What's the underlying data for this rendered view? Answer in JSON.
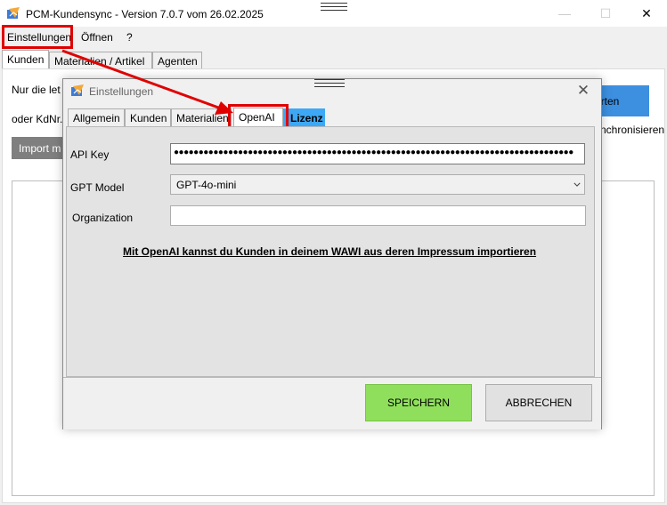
{
  "window": {
    "title": "PCM-Kundensync - Version 7.0.7 vom 26.02.2025",
    "minimize_glyph": "—",
    "maximize_glyph": "☐",
    "close_glyph": "✕"
  },
  "menu": {
    "items": [
      "Einstellungen",
      "Öffnen",
      "?"
    ]
  },
  "main_tabs": [
    "Kunden",
    "Materialien / Artikel",
    "Agenten"
  ],
  "main": {
    "line1_text": "Nur die let",
    "line2_text": "oder KdNr.",
    "import_button": "Import m",
    "start_button": "arten",
    "sync_text": "ynchronisieren"
  },
  "dialog": {
    "title": "Einstellungen",
    "close_glyph": "✕",
    "tabs": [
      "Allgemein",
      "Kunden",
      "Materialien",
      "OpenAI",
      "Lizenz"
    ],
    "api_key_label": "API Key",
    "api_key_value": "●●●●●●●●●●●●●●●●●●●●●●●●●●●●●●●●●●●●●●●●●●●●●●●●●●●●●●●●●●●●●●●●●●●●●●●●●●●●●●●●●",
    "gpt_model_label": "GPT Model",
    "gpt_model_value": "GPT-4o-mini",
    "organization_label": "Organization",
    "organization_value": "",
    "info_link": "Mit OpenAI kannst du Kunden in deinem WAWI aus deren Impressum importieren",
    "save_button": "SPEICHERN",
    "cancel_button": "ABBRECHEN"
  },
  "colors": {
    "highlight": "#e00000",
    "save_green": "#8fdf5c",
    "license_tab_blue": "#3da8f5",
    "start_blue": "#3d8fe0"
  },
  "icons": {
    "app": "app-logo-icon",
    "chevron": "chevron-down-icon"
  }
}
